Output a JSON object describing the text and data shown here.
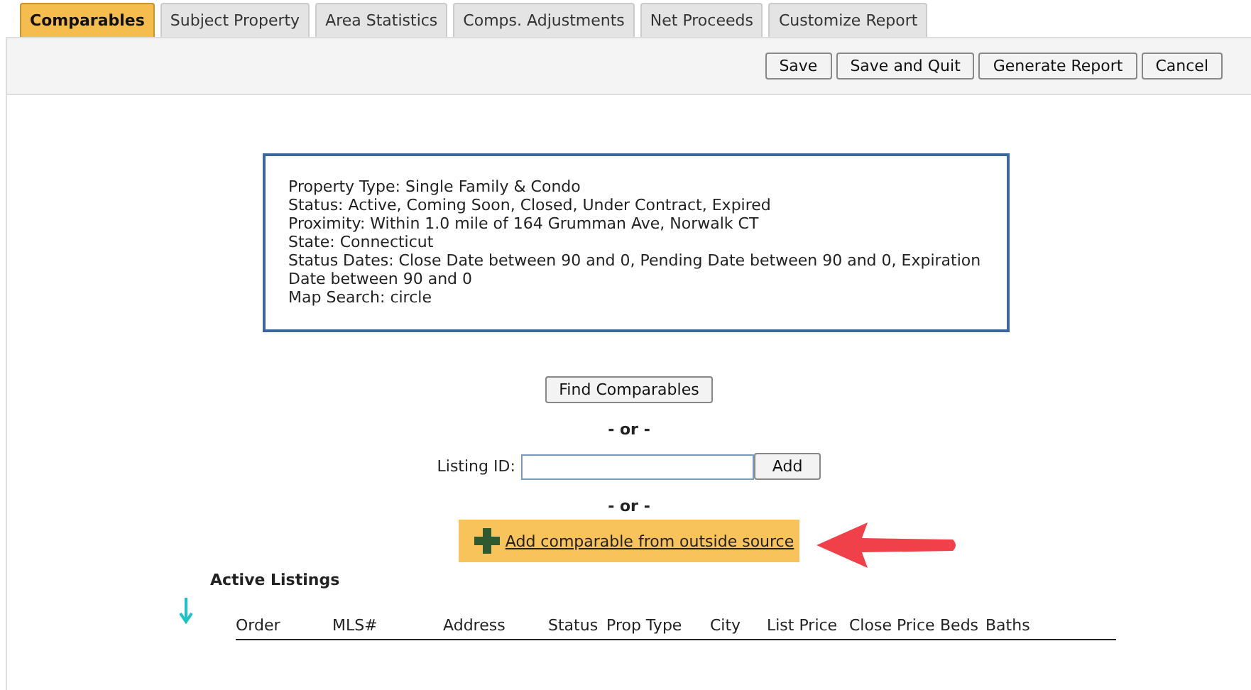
{
  "tabs": [
    {
      "label": "Comparables",
      "selected": true
    },
    {
      "label": "Subject Property",
      "selected": false
    },
    {
      "label": "Area Statistics",
      "selected": false
    },
    {
      "label": "Comps. Adjustments",
      "selected": false
    },
    {
      "label": "Net Proceeds",
      "selected": false
    },
    {
      "label": "Customize Report",
      "selected": false
    }
  ],
  "toolbar": {
    "buttons": [
      "Save",
      "Save and Quit",
      "Generate Report",
      "Cancel"
    ]
  },
  "criteria": [
    "Property Type: Single Family & Condo",
    "Status: Active, Coming Soon, Closed, Under Contract, Expired",
    "Proximity: Within 1.0 mile of 164 Grumman Ave, Norwalk CT",
    "State: Connecticut",
    "Status Dates: Close Date between 90 and 0, Pending Date between 90 and 0, Expiration Date between 90 and 0",
    "Map Search: circle"
  ],
  "find_button": "Find Comparables",
  "separator_1": "- or -",
  "listing_id": {
    "label": "Listing ID:",
    "add_button": "Add"
  },
  "separator_2": "- or -",
  "outside_source_link": "Add comparable from outside source",
  "active_listings": {
    "title": "Active Listings",
    "columns": [
      "Order",
      "MLS#",
      "Address",
      "Status",
      "Prop Type",
      "City",
      "List Price",
      "Close Price",
      "Beds",
      "Baths"
    ]
  }
}
